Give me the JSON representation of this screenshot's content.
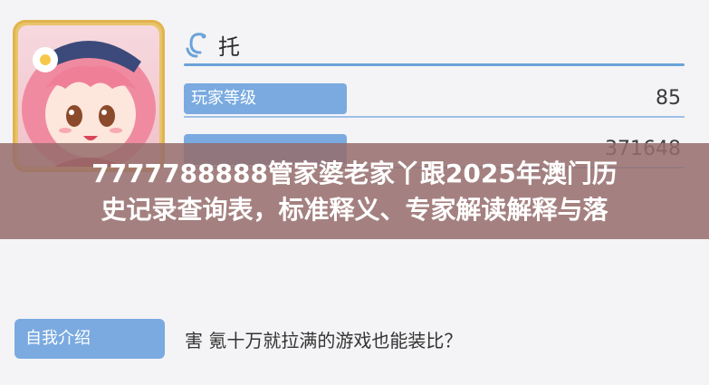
{
  "profile": {
    "name": "托",
    "stats": [
      {
        "label": "玩家等级",
        "value": "85"
      },
      {
        "label": "",
        "value": "371648"
      }
    ],
    "intro_label": "自我介绍",
    "intro_text": "害 氪十万就拉满的游戏也能装比？"
  },
  "banner": {
    "line1": "7777788888管家婆老家丫跟2025年澳门历",
    "line2": "史记录查询表，标准释义、专家解读解释与落"
  },
  "icons": {
    "name_icon": "swirl-icon",
    "avatar": "anime-character-avatar"
  },
  "colors": {
    "label_bg": "#7aaae0",
    "underline": "#6aa3d8",
    "banner_bg": "#966e6c",
    "frame": "#e8c46a"
  }
}
